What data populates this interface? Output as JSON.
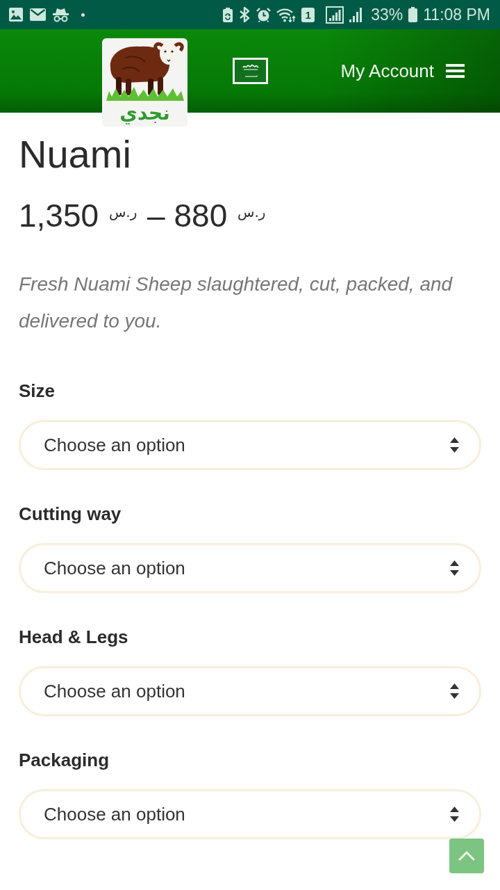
{
  "status_bar": {
    "sim_slot": "1",
    "battery": "33%",
    "time": "11:08 PM"
  },
  "header": {
    "logo_text": "نجدي",
    "account_link": "My Account"
  },
  "product": {
    "title": "Nuami",
    "price_range": "1,350 $^{ر.س}$ – 880 $^{ر.س}$",
    "description": "Fresh Nuami Sheep slaughtered, cut, packed, and delivered to you."
  },
  "options": [
    {
      "label": "Size",
      "value": "Choose an option"
    },
    {
      "label": "Cutting way",
      "value": "Choose an option"
    },
    {
      "label": "Head & Legs",
      "value": "Choose an option"
    },
    {
      "label": "Packaging",
      "value": "Choose an option"
    }
  ]
}
